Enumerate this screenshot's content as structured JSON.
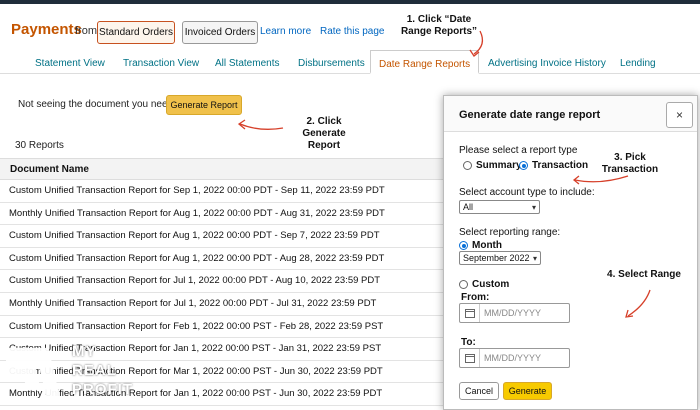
{
  "header": {
    "title": "Payments",
    "from_label": "from",
    "standard_orders": "Standard Orders",
    "invoiced_orders": "Invoiced Orders",
    "learn_more": "Learn more",
    "rate_page": "Rate this page"
  },
  "tabs": [
    {
      "label": "Statement View"
    },
    {
      "label": "Transaction View"
    },
    {
      "label": "All Statements"
    },
    {
      "label": "Disbursements"
    },
    {
      "label": "Date Range Reports"
    },
    {
      "label": "Advertising Invoice History"
    },
    {
      "label": "Lending"
    }
  ],
  "active_tab": "Date Range Reports",
  "banner": {
    "text": "Not seeing the document you need?",
    "button": "Generate Report"
  },
  "reports": {
    "count": "30 Reports",
    "column": "Document Name",
    "rows": [
      "Custom Unified Transaction Report for Sep 1, 2022 00:00 PDT - Sep 11, 2022 23:59 PDT",
      "Monthly Unified Transaction Report for Aug 1, 2022 00:00 PDT - Aug 31, 2022 23:59 PDT",
      "Custom Unified Transaction Report for Aug 1, 2022 00:00 PDT - Sep 7, 2022 23:59 PDT",
      "Custom Unified Transaction Report for Aug 1, 2022 00:00 PDT - Aug 28, 2022 23:59 PDT",
      "Custom Unified Transaction Report for Jul 1, 2022 00:00 PDT - Aug 10, 2022 23:59 PDT",
      "Monthly Unified Transaction Report for Jul 1, 2022 00:00 PDT - Jul 31, 2022 23:59 PDT",
      "Custom Unified Transaction Report for Feb 1, 2022 00:00 PST - Feb 28, 2022 23:59 PST",
      "Custom Unified Transaction Report for Jan 1, 2022 00:00 PST - Jan 31, 2022 23:59 PST",
      "Custom Unified Transaction Report for Mar 1, 2022 00:00 PST - Jun 30, 2022 23:59 PDT",
      "Monthly Unified Transaction Report for Jan 1, 2022 00:00 PST - Jun 30, 2022 23:59 PDT"
    ]
  },
  "modal": {
    "title": "Generate date range report",
    "close": "×",
    "report_type_label": "Please select a report type",
    "summary": "Summary",
    "transaction": "Transaction",
    "selected_type": "Transaction",
    "account_type_label": "Select account type to include:",
    "account_type_value": "All",
    "range_label": "Select reporting range:",
    "month": "Month",
    "month_value": "September 2022",
    "custom": "Custom",
    "from": "From:",
    "to": "To:",
    "date_placeholder": "MM/DD/YYYY",
    "cancel": "Cancel",
    "generate": "Generate"
  },
  "annotations": {
    "step1_line1": "1. Click “Date",
    "step1_line2": "Range Reports”",
    "step2_line1": "2. Click",
    "step2_line2": "Generate Report",
    "step3_line1": "3. Pick",
    "step3_line2": "Transaction",
    "step4": "4. Select Range"
  },
  "logo": {
    "line1": "MY",
    "line2": "REAL",
    "line3": "PROFIT"
  },
  "colors": {
    "accent_orange": "#c45500",
    "link_teal": "#007185",
    "button_yellow": "#f0c14b",
    "annotation_red": "#d6402a",
    "radio_blue": "#0a70d6"
  },
  "icons": {
    "close": "close-icon",
    "calendar": "calendar-icon",
    "dropdown": "chevron-down-icon",
    "logo": "my-real-profit-logo"
  }
}
